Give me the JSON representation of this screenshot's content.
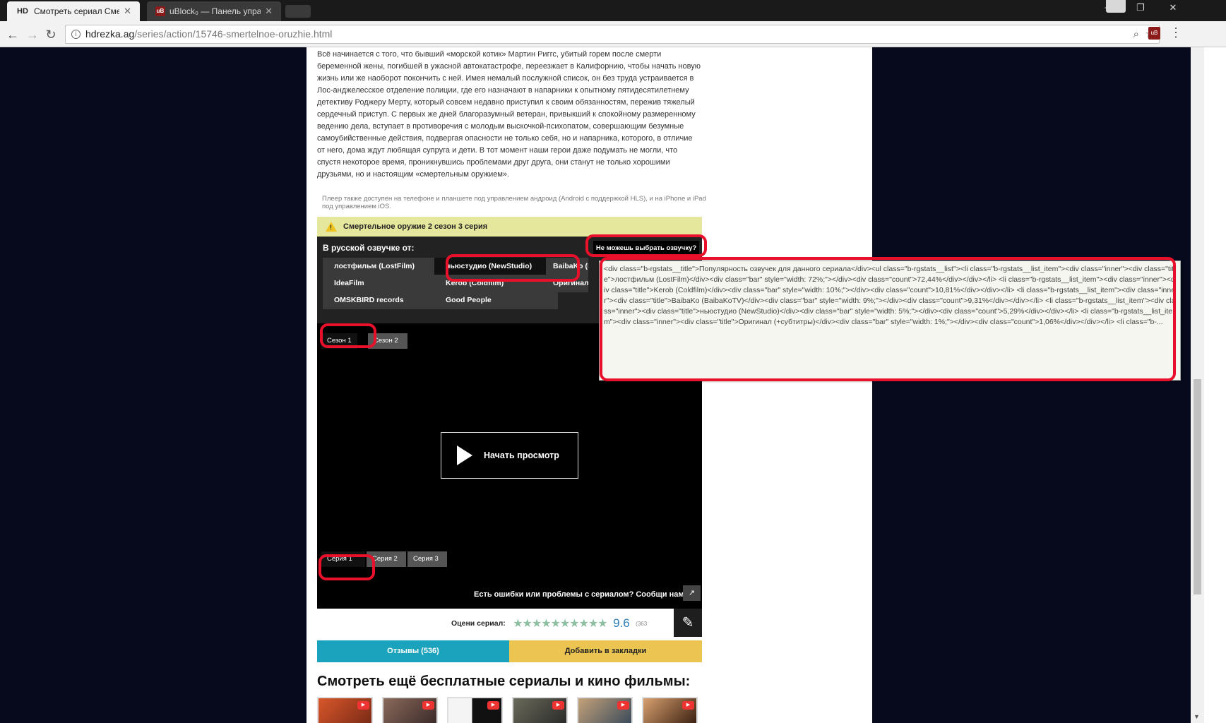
{
  "browser": {
    "tabs": [
      {
        "favicon": "HD",
        "title": "Смотреть сериал Смерт"
      },
      {
        "favicon": "uB",
        "title": "uBlock₀ — Панель упра"
      }
    ],
    "url_host": "hdrezka.ag",
    "url_path": "/series/action/15746-smertelnoe-oruzhie.html"
  },
  "description": "Всё начинается с того, что бывший «морской котик» Мартин Риггс, убитый горем после смерти беременной жены, погибшей в ужасной автокатастрофе, переезжает в Калифорнию, чтобы начать новую жизнь или же наоборот покончить с ней. Имея немалый послужной список, он без труда устраивается в Лос-анджелесское отделение полиции, где его назначают в напарники к опытному пятидесятилетнему детективу Роджеру Мерту, который совсем недавно приступил к своим обязанностям, пережив тяжелый сердечный приступ. С первых же дней благоразумный ветеран, привыкший к спокойному размеренному ведению дела, вступает в противоречия с молодым выскочкой-психопатом, совершающим безумные самоубийственные действия, подвергая опасности не только себя, но и напарника, которого, в отличие от него, дома ждут любящая супруга и дети. В тот момент наши герои даже подумать не могли, что спустя некоторое время, проникнувшись проблемами друг друга, они станут не только хорошими друзьями, но и настоящим «смертельным оружием».",
  "device_note": "Плеер также доступен на телефоне и планшете под управлением андроид (Android с поддержкой HLS), и на iPhone и iPad под управлением iOS.",
  "player": {
    "episode_title": "Смертельное оружие 2 сезон 3 серия",
    "translators_title": "В русской озвучке от:",
    "cant_choose": "Не можешь выбрать озвучку?",
    "translators": [
      {
        "label": "лостфильм (LostFilm)"
      },
      {
        "label": "ньюстудио (NewStudio)"
      },
      {
        "label": "BaibaKo (BaibaKoTV)"
      },
      {
        "label": "IdeaFilm"
      },
      {
        "label": "Kerob (Coldfilm)"
      },
      {
        "label": "Оригинал (+субтитры)"
      },
      {
        "label": "OMSKBIRD records"
      },
      {
        "label": "Good People"
      }
    ],
    "active_translator": "ньюстудио (NewStudio)",
    "seasons": [
      "Сезон 1",
      "Сезон 2"
    ],
    "active_season": "Сезон 1",
    "play_label": "Начать просмотр",
    "episodes": [
      "Серия 1",
      "Серия 2",
      "Серия 3"
    ],
    "active_episode": "Серия 1",
    "report": "Есть ошибки или проблемы с сериалом? Сообщи нам!"
  },
  "rating": {
    "label": "Оцени сериал:",
    "stars": "★★★★★★★★★★",
    "value": "9.6",
    "count": "(363"
  },
  "buttons": {
    "reviews": "Отзывы (536)",
    "bookmark": "Добавить в закладки"
  },
  "more_title": "Смотреть ещё бесплатные сериалы и кино фильмы:",
  "tooltip": "<div class=\"b-rgstats__title\">Популярность озвучек для данного сериала</div><ul class=\"b-rgstats__list\"><li class=\"b-rgstats__list_item\"><div class=\"inner\"><div class=\"title\">лостфильм (LostFilm)</div><div class=\"bar\" style=\"width: 72%;\"></div><div class=\"count\">72,44%</div></div></li>\n<li class=\"b-rgstats__list_item\"><div class=\"inner\"><div class=\"title\">Kerob (Coldfilm)</div><div class=\"bar\" style=\"width: 10%;\"></div><div class=\"count\">10,81%</div></div></li>\n<li class=\"b-rgstats__list_item\"><div class=\"inner\"><div class=\"title\">BaibaKo (BaibaKoTV)</div><div class=\"bar\" style=\"width: 9%;\"></div><div class=\"count\">9,31%</div></div></li>\n<li class=\"b-rgstats__list_item\"><div class=\"inner\"><div class=\"title\">ньюстудио (NewStudio)</div><div class=\"bar\" style=\"width: 5%;\"></div><div class=\"count\">5,29%</div></div></li>\n<li class=\"b-rgstats__list_item\"><div class=\"inner\"><div class=\"title\">Оригинал (+субтитры)</div><div class=\"bar\" style=\"width: 1%;\"></div><div class=\"count\">1,06%</div></div></li>\n<li class=\"b-...",
  "colors": {
    "annotation": "#e8102a",
    "reviews": "#1ba3bd",
    "bookmark": "#ecc452",
    "episode_bar": "#e5e79c",
    "rating_value": "#2a7fb8"
  }
}
